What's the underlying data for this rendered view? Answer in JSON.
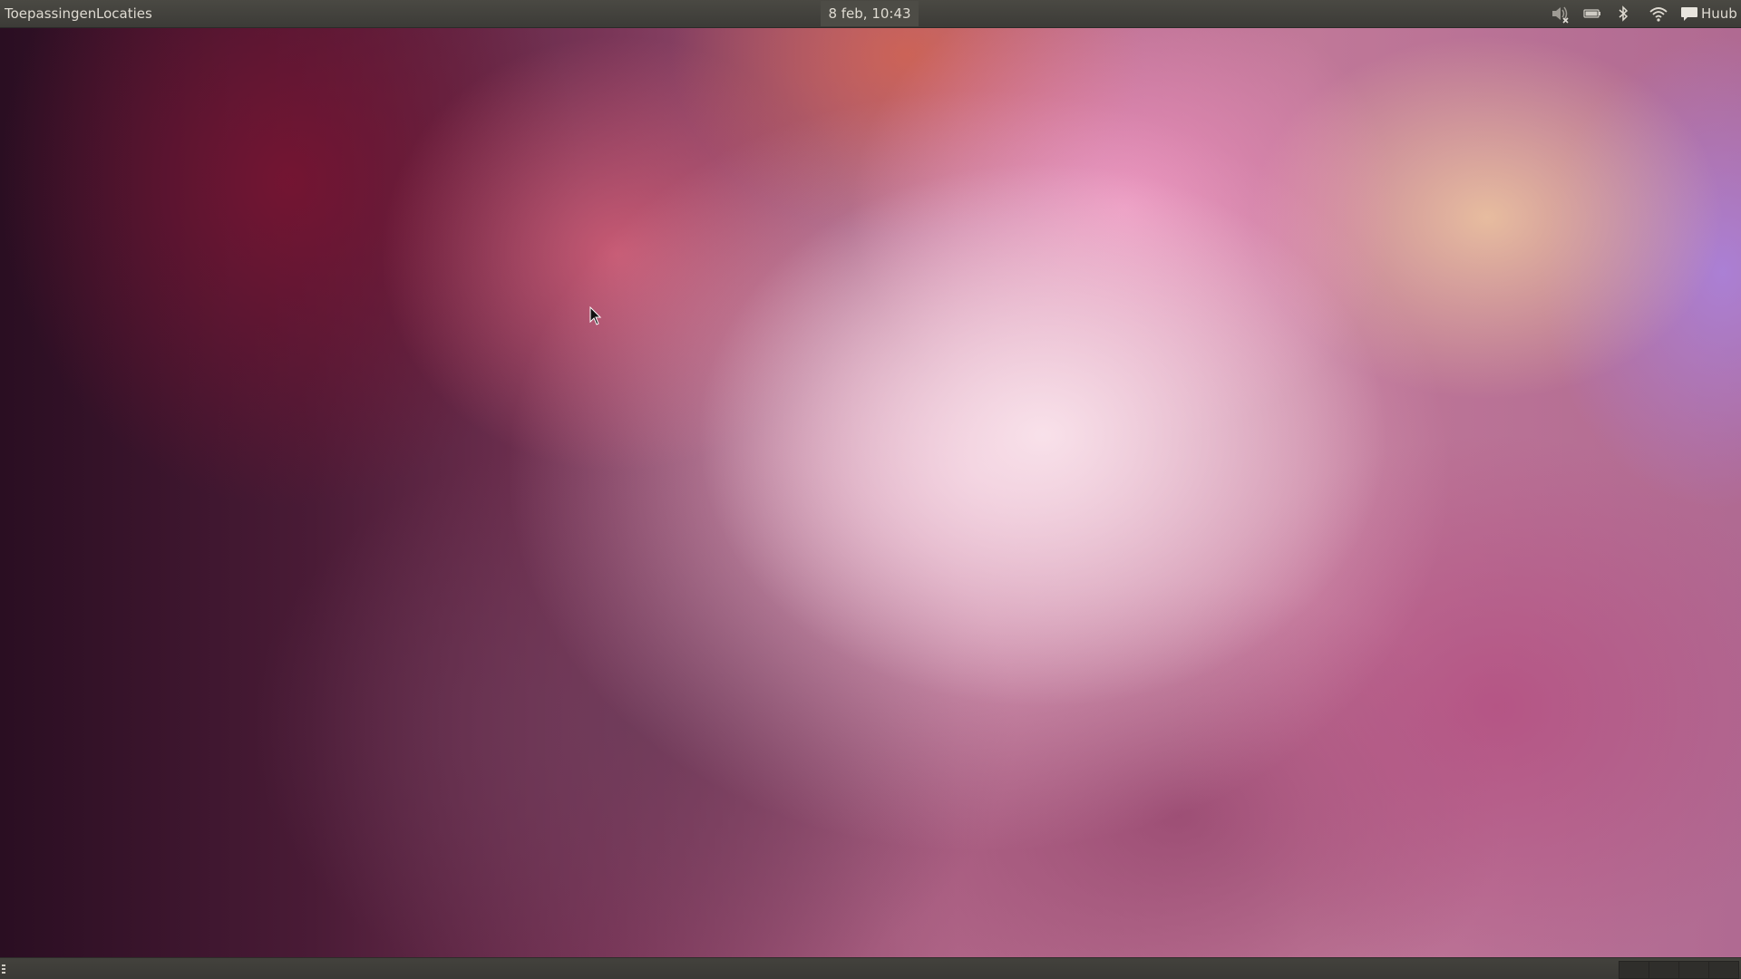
{
  "top_panel": {
    "menus": [
      {
        "label": "Toepassingen"
      },
      {
        "label": "Locaties"
      }
    ],
    "clock": "8 feb, 10:43",
    "tray_icons": [
      "volume-muted-icon",
      "battery-icon",
      "bluetooth-icon",
      "wifi-icon",
      "chat-icon"
    ],
    "user": "Huub"
  },
  "bottom_panel": {
    "workspaces": 4
  },
  "colors": {
    "panel": "#3c3b37",
    "panel_text": "#dfdbd2"
  }
}
